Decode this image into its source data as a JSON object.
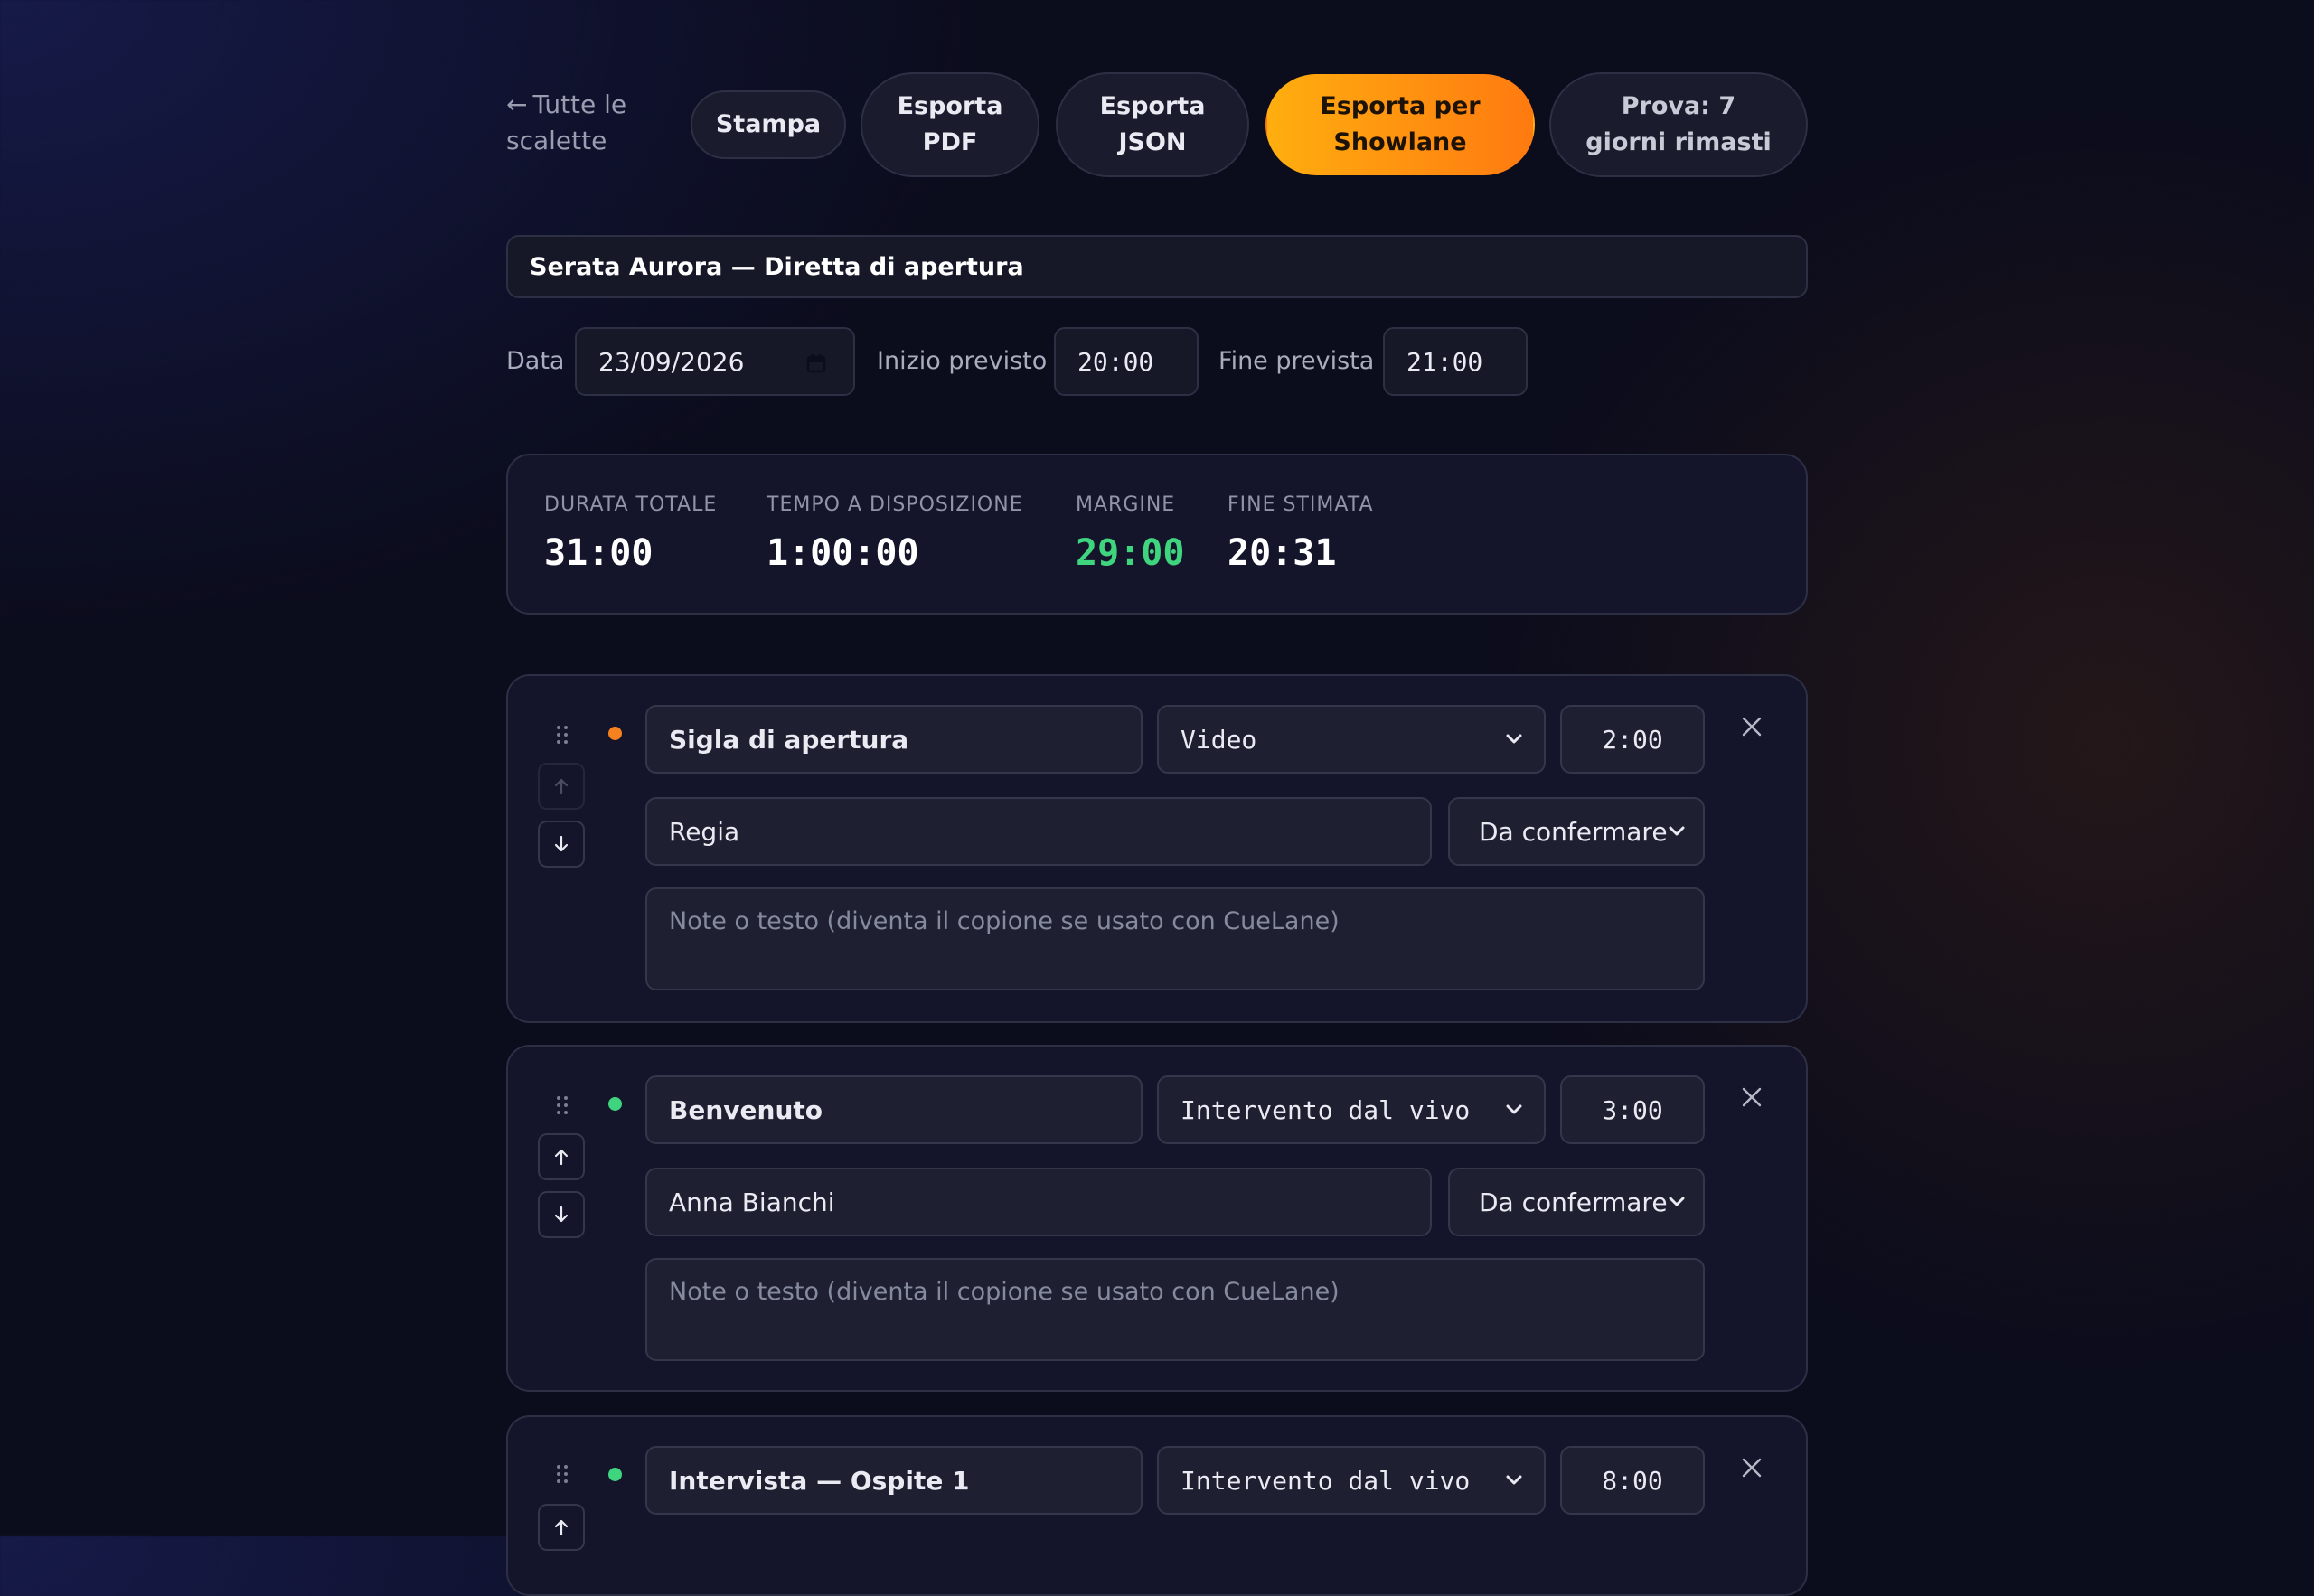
{
  "toolbar": {
    "back_label": "Tutte le scalette",
    "print_label": "Stampa",
    "export_pdf_label": "Esporta PDF",
    "export_json_label": "Esporta JSON",
    "export_showlane_label": "Esporta per Showlane",
    "trial_label": "Prova: 7 giorni rimasti"
  },
  "show": {
    "title": "Serata Aurora — Diretta di apertura",
    "date_label": "Data",
    "date_value": "23/09/2026",
    "start_label": "Inizio previsto",
    "start_value": "20:00",
    "end_label": "Fine prevista",
    "end_value": "21:00"
  },
  "summary": {
    "total_label": "DURATA TOTALE",
    "total_value": "31:00",
    "available_label": "TEMPO A DISPOSIZIONE",
    "available_value": "1:00:00",
    "margin_label": "MARGINE",
    "margin_value": "29:00",
    "end_label": "FINE STIMATA",
    "end_value": "20:31"
  },
  "segments": [
    {
      "title": "Sigla di apertura",
      "type": "Video",
      "duration": "2:00",
      "owner": "Regia",
      "status": "Da confermare",
      "notes_placeholder": "Note o testo (diventa il copione se usato con CueLane)",
      "dot_color": "#f5821f"
    },
    {
      "title": "Benvenuto",
      "type": "Intervento dal vivo",
      "duration": "3:00",
      "owner": "Anna Bianchi",
      "status": "Da confermare",
      "notes_placeholder": "Note o testo (diventa il copione se usato con CueLane)",
      "dot_color": "#3fd47e"
    },
    {
      "title": "Intervista — Ospite 1",
      "type": "Intervento dal vivo",
      "duration": "8:00",
      "dot_color": "#3fd47e"
    }
  ],
  "colors": {
    "accent_start": "#ffae0f",
    "accent_end": "#ff7a10",
    "good": "#3fd47e",
    "background": "#0b0c1c"
  }
}
